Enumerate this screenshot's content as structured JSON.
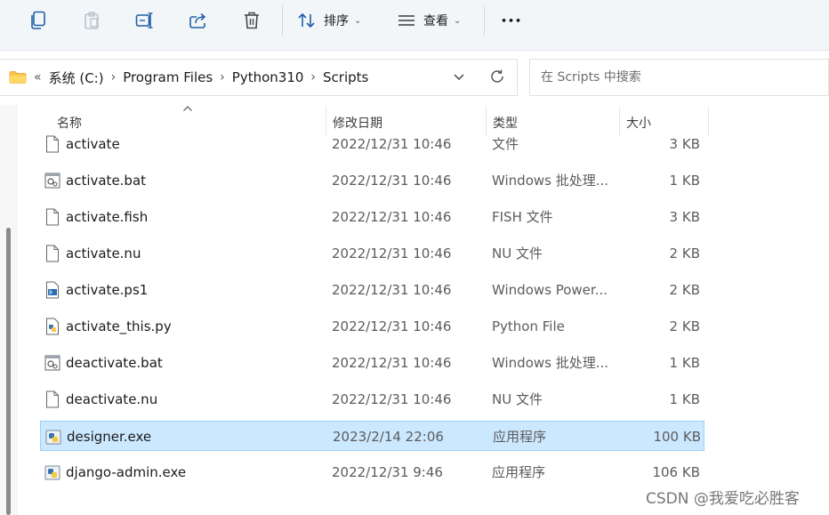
{
  "toolbar": {
    "sort_label": "排序",
    "view_label": "查看",
    "more_label": "•••"
  },
  "address": {
    "back_label": "«",
    "crumbs": [
      "系统 (C:)",
      "Program Files",
      "Python310",
      "Scripts"
    ],
    "separator": "›"
  },
  "search": {
    "placeholder": "在 Scripts 中搜索"
  },
  "columns": {
    "name": "名称",
    "modified": "修改日期",
    "type": "类型",
    "size": "大小"
  },
  "files": [
    {
      "name": "activate",
      "modified": "2022/12/31 10:46",
      "type": "文件",
      "size": "3 KB",
      "icon": "file-icon"
    },
    {
      "name": "activate.bat",
      "modified": "2022/12/31 10:46",
      "type": "Windows 批处理...",
      "size": "1 KB",
      "icon": "batch-file-icon"
    },
    {
      "name": "activate.fish",
      "modified": "2022/12/31 10:46",
      "type": "FISH 文件",
      "size": "3 KB",
      "icon": "file-icon"
    },
    {
      "name": "activate.nu",
      "modified": "2022/12/31 10:46",
      "type": "NU 文件",
      "size": "2 KB",
      "icon": "file-icon"
    },
    {
      "name": "activate.ps1",
      "modified": "2022/12/31 10:46",
      "type": "Windows Power...",
      "size": "2 KB",
      "icon": "powershell-file-icon"
    },
    {
      "name": "activate_this.py",
      "modified": "2022/12/31 10:46",
      "type": "Python File",
      "size": "2 KB",
      "icon": "python-file-icon"
    },
    {
      "name": "deactivate.bat",
      "modified": "2022/12/31 10:46",
      "type": "Windows 批处理...",
      "size": "1 KB",
      "icon": "batch-file-icon"
    },
    {
      "name": "deactivate.nu",
      "modified": "2022/12/31 10:46",
      "type": "NU 文件",
      "size": "1 KB",
      "icon": "file-icon"
    },
    {
      "name": "designer.exe",
      "modified": "2023/2/14 22:06",
      "type": "应用程序",
      "size": "100 KB",
      "icon": "python-exe-icon",
      "selected": true
    },
    {
      "name": "django-admin.exe",
      "modified": "2022/12/31 9:46",
      "type": "应用程序",
      "size": "106 KB",
      "icon": "python-exe-icon"
    }
  ],
  "watermark": "CSDN @我爱吃必胜客",
  "colors": {
    "selection_bg": "#cce8ff",
    "selection_border": "#99d1ff",
    "toolbar_bg": "#f3f6f9"
  }
}
